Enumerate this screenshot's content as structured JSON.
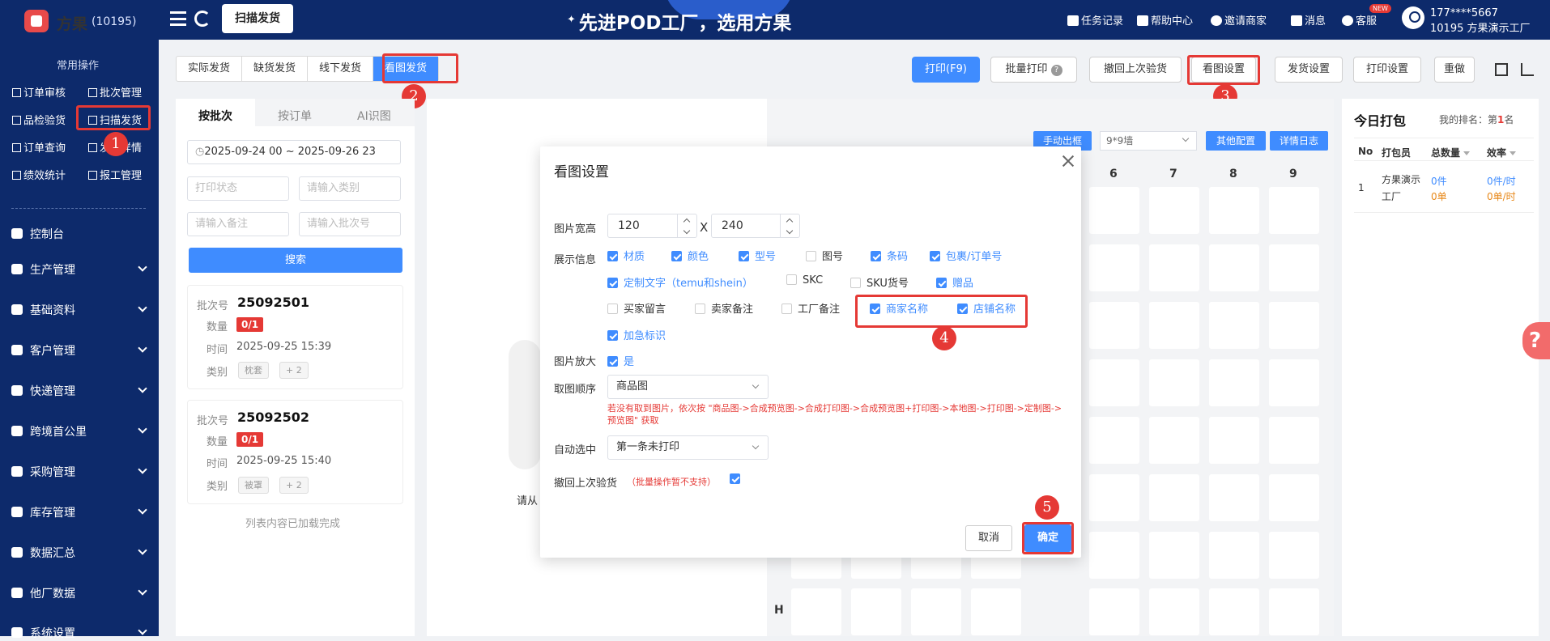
{
  "topbar": {
    "brand": "方果",
    "brand_count": "(10195)",
    "active_tab": "扫描发货",
    "slogan": "先进POD工厂，选用方果",
    "links": [
      "任务记录",
      "帮助中心",
      "邀请商家",
      "消息",
      "客服"
    ],
    "new_badge": "NEW",
    "user_phone": "177****5667",
    "user_org": "10195 方果演示工厂"
  },
  "sidebar": {
    "section_title": "常用操作",
    "quick": [
      "订单审核",
      "批次管理",
      "品检验货",
      "扫描发货",
      "订单查询",
      "发货详情",
      "绩效统计",
      "报工管理"
    ],
    "nav": [
      "控制台",
      "生产管理",
      "基础资料",
      "客户管理",
      "快递管理",
      "跨境首公里",
      "采购管理",
      "库存管理",
      "数据汇总",
      "他厂数据",
      "系统设置"
    ]
  },
  "steps": [
    "1",
    "2",
    "3",
    "4",
    "5"
  ],
  "mode_tabs": [
    "实际发货",
    "缺货发货",
    "线下发货",
    "看图发货"
  ],
  "toolbar": {
    "print": "打印(F9)",
    "batch_print": "批量打印",
    "help_q": "?",
    "undo_check": "撤回上次验货",
    "view_settings": "看图设置",
    "ship_settings": "发货设置",
    "print_settings": "打印设置",
    "reset": "重做"
  },
  "left_panel": {
    "tabs": [
      "按批次",
      "按订单",
      "AI识图"
    ],
    "date_range": "2025-09-24 00  ~  2025-09-26 23",
    "print_status_ph": "打印状态",
    "category_ph": "请输入类别",
    "remark_ph": "请输入备注",
    "batch_ph": "请输入批次号",
    "search": "搜索",
    "labels": {
      "batch": "批次号",
      "qty": "数量",
      "time": "时间",
      "cat": "类别"
    },
    "batches": [
      {
        "no": "25092501",
        "qty": "0/1",
        "time": "2025-09-25 15:39",
        "cat": "枕套",
        "more": "+ 2"
      },
      {
        "no": "25092502",
        "qty": "0/1",
        "time": "2025-09-25 15:40",
        "cat": "被罩",
        "more": "+ 2"
      }
    ],
    "list_end": "列表内容已加载完成"
  },
  "center": {
    "hint": "请从"
  },
  "grid": {
    "btn_manual": "手动出框",
    "grid_size": "9*9墙",
    "btn_other": "其他配置",
    "btn_log": "详情日志",
    "cols": [
      "6",
      "7",
      "8",
      "9"
    ],
    "row_label": "H"
  },
  "today": {
    "title": "今日打包",
    "rank_label": "我的排名：第",
    "rank_value": "1",
    "rank_suffix": "名",
    "headers": [
      "No",
      "打包员",
      "总数量",
      "效率"
    ],
    "row": {
      "no": "1",
      "packer_1": "方果演示",
      "packer_2": "工厂",
      "pieces": "0件",
      "orders": "0单",
      "rate_p": "0件/时",
      "rate_o": "0单/时"
    }
  },
  "modal": {
    "title": "看图设置",
    "size_label": "图片宽高",
    "width": "120",
    "times": "X",
    "height": "240",
    "display_label": "展示信息",
    "options": [
      {
        "label": "材质",
        "checked": true
      },
      {
        "label": "颜色",
        "checked": true
      },
      {
        "label": "型号",
        "checked": true
      },
      {
        "label": "图号",
        "checked": false
      },
      {
        "label": "条码",
        "checked": true
      },
      {
        "label": "包裹/订单号",
        "checked": true
      },
      {
        "label": "定制文字（temu和shein）",
        "checked": true
      },
      {
        "label": "SKC",
        "checked": false
      },
      {
        "label": "SKU货号",
        "checked": false
      },
      {
        "label": "赠品",
        "checked": true
      },
      {
        "label": "买家留言",
        "checked": false
      },
      {
        "label": "卖家备注",
        "checked": false
      },
      {
        "label": "工厂备注",
        "checked": false
      },
      {
        "label": "商家名称",
        "checked": true
      },
      {
        "label": "店铺名称",
        "checked": true
      },
      {
        "label": "加急标识",
        "checked": true
      }
    ],
    "zoom_label": "图片放大",
    "zoom_value": "是",
    "order_label": "取图顺序",
    "order_value": "商品图",
    "order_hint": "若没有取到图片，依次按 \"商品图->合成预览图->合成打印图->合成预览图+打印图->本地图->打印图->定制图->预览图\" 获取",
    "auto_label": "自动选中",
    "auto_value": "第一条未打印",
    "undo_label": "撤回上次验货",
    "undo_note": "（批量操作暂不支持）",
    "cancel": "取消",
    "ok": "确定"
  }
}
